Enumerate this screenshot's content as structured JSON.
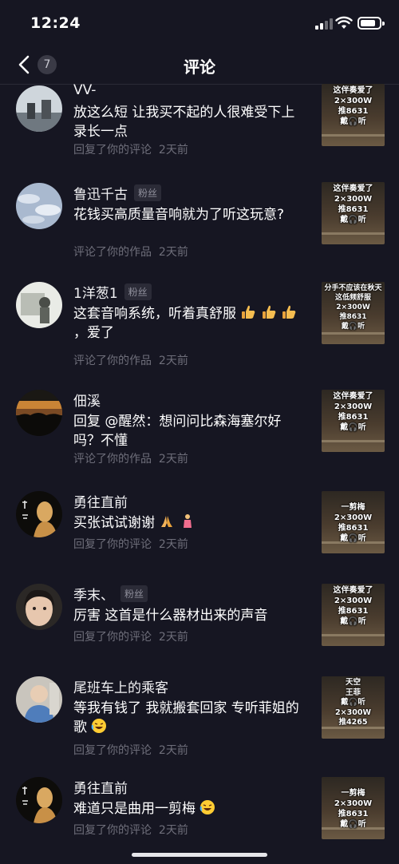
{
  "status": {
    "time": "12:24"
  },
  "nav": {
    "back_count": "7",
    "title": "评论"
  },
  "comments": [
    {
      "name": "VV-",
      "tag": "",
      "text": "放这么短 让我买不起的人很难受下上录长一点",
      "meta_action": "回复了你的评论",
      "meta_time": "2天前",
      "thumb_lines": [
        "这伴奏爱了",
        "2×300W",
        "推8631",
        "戴🎧听"
      ]
    },
    {
      "name": "鲁迅千古",
      "tag": "粉丝",
      "text": "花钱买高质量音响就为了听这玩意?",
      "meta_action": "评论了你的作品",
      "meta_time": "2天前",
      "thumb_lines": [
        "这伴奏爱了",
        "2×300W",
        "推8631",
        "戴🎧听"
      ]
    },
    {
      "name": "1洋葱1",
      "tag": "粉丝",
      "text": "这套音响系统，听着真舒服",
      "text_tail": "，爱了",
      "meta_action": "评论了你的作品",
      "meta_time": "2天前",
      "thumb_lines": [
        "分手不应该在秋天",
        "这低频舒服",
        "2×300W",
        "推8631",
        "戴🎧听"
      ]
    },
    {
      "name": "佃溪",
      "tag": "",
      "text": "回复 @醒然：想问问比森海塞尔好吗？不懂",
      "meta_action": "评论了你的作品",
      "meta_time": "2天前",
      "thumb_lines": [
        "这伴奏爱了",
        "2×300W",
        "推8631",
        "戴🎧听"
      ]
    },
    {
      "name": "勇往直前",
      "tag": "",
      "text": "买张试试谢谢",
      "meta_action": "回复了你的评论",
      "meta_time": "2天前",
      "thumb_lines": [
        "一剪梅",
        "2×300W",
        "推8631",
        "戴🎧听"
      ]
    },
    {
      "name": "季末、",
      "tag": "粉丝",
      "text": "厉害 这首是什么器材出来的声音",
      "meta_action": "回复了你的评论",
      "meta_time": "2天前",
      "thumb_lines": [
        "这伴奏爱了",
        "2×300W",
        "推8631",
        "戴🎧听"
      ]
    },
    {
      "name": "尾班车上的乘客",
      "tag": "",
      "text": "等我有钱了 我就搬套回家 专听菲姐的歌",
      "meta_action": "回复了你的评论",
      "meta_time": "2天前",
      "thumb_lines": [
        "天空",
        "王菲",
        "戴🎧听",
        "2×300W",
        "推4265"
      ]
    },
    {
      "name": "勇往直前",
      "tag": "",
      "text": "难道只是曲用一剪梅",
      "meta_action": "回复了你的评论",
      "meta_time": "2天前",
      "thumb_lines": [
        "一剪梅",
        "2×300W",
        "推8631",
        "戴🎧听"
      ]
    }
  ],
  "icons": {
    "back": "chevron-left-icon",
    "thumbs_up": "thumbs-up-emoji",
    "pray": "pray-emoji",
    "laugh": "laughing-emoji"
  },
  "colors": {
    "background": "#161622",
    "meta": "#6e6e7a",
    "tag_bg": "#2b2b37"
  }
}
